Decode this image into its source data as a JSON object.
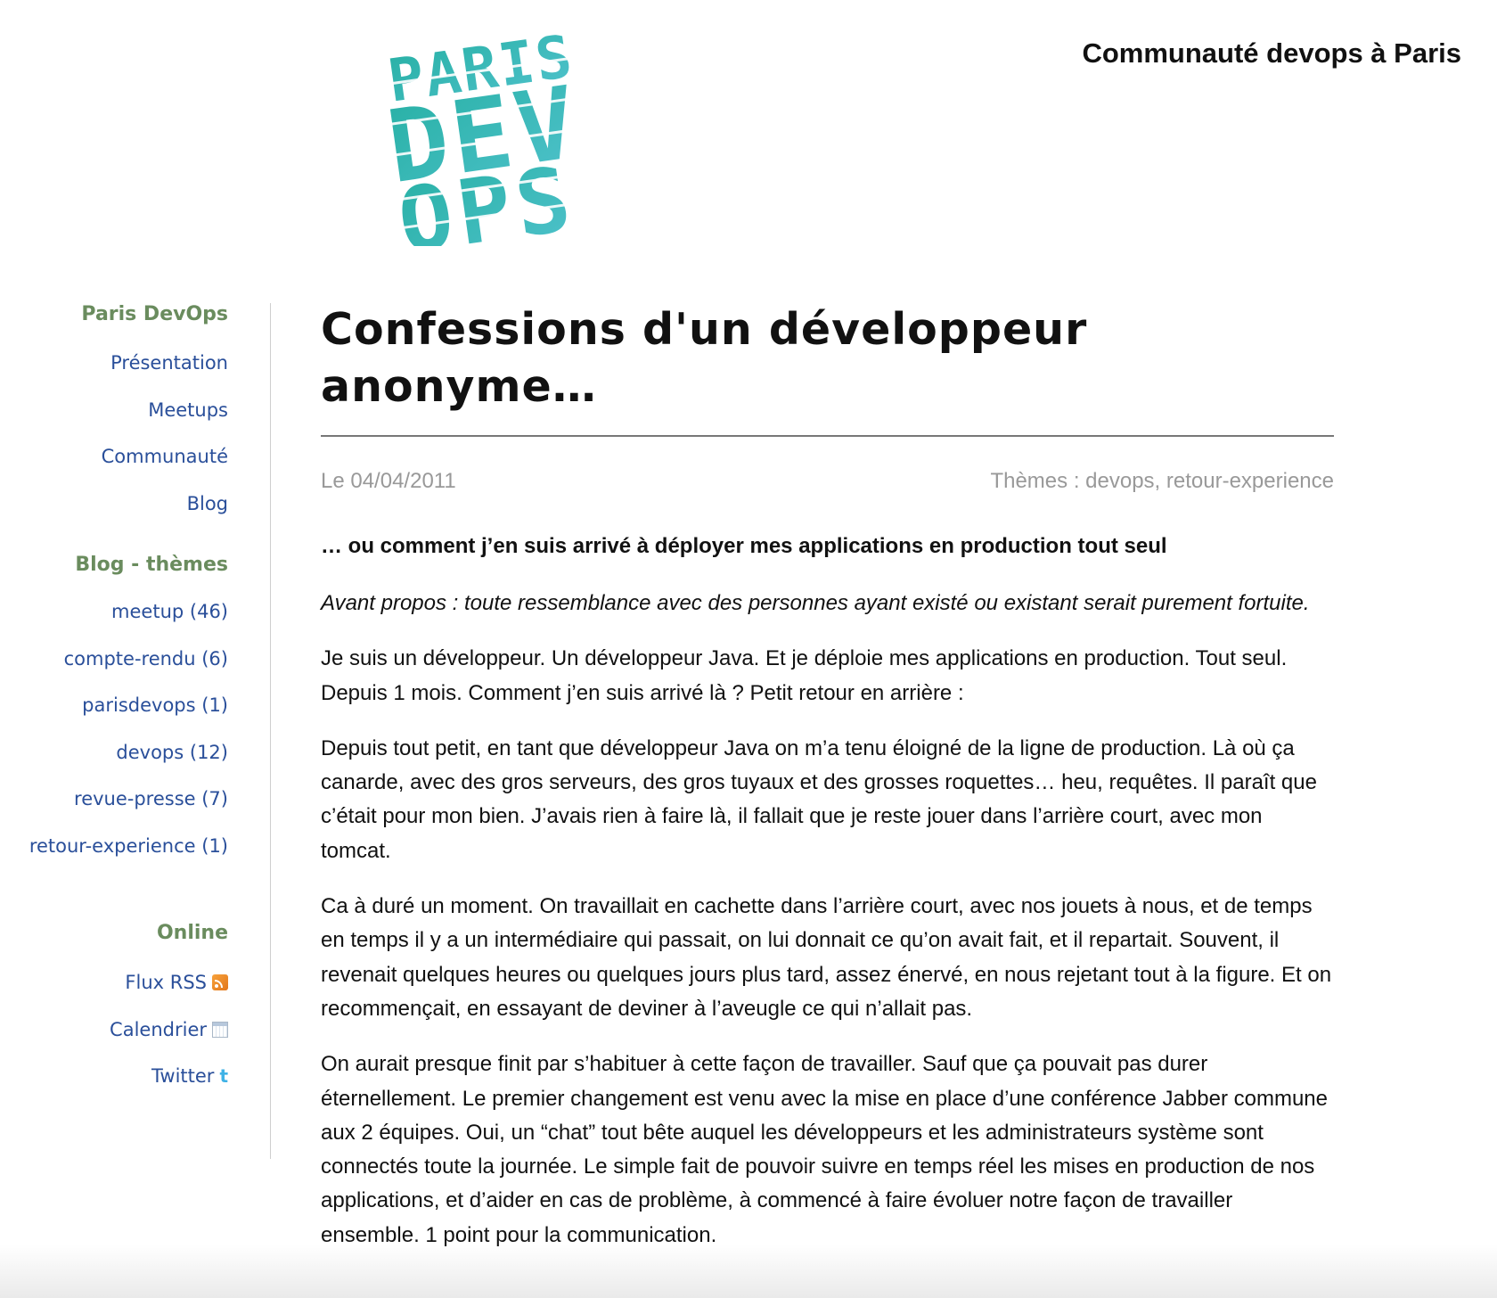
{
  "header": {
    "logo_lines": [
      "PARIS",
      "DEV",
      "OPS"
    ],
    "tagline": "Communauté devops à Paris"
  },
  "sidebar": {
    "section1": {
      "heading": "Paris DevOps",
      "items": [
        {
          "label": "Présentation"
        },
        {
          "label": "Meetups"
        },
        {
          "label": "Communauté"
        },
        {
          "label": "Blog"
        }
      ]
    },
    "section2": {
      "heading": "Blog - thèmes",
      "items": [
        {
          "label": "meetup (46)"
        },
        {
          "label": "compte-rendu (6)"
        },
        {
          "label": "parisdevops (1)"
        },
        {
          "label": "devops (12)"
        },
        {
          "label": "revue-presse (7)"
        },
        {
          "label": "retour-experience (1)"
        }
      ]
    },
    "section3": {
      "heading": "Online",
      "items": [
        {
          "label": "Flux RSS",
          "icon": "rss-icon"
        },
        {
          "label": "Calendrier",
          "icon": "calendar-icon"
        },
        {
          "label": "Twitter",
          "icon": "twitter-icon",
          "glyph": "t"
        }
      ]
    }
  },
  "post": {
    "title_line1": "Confessions d'un développeur",
    "title_line2": "anonyme…",
    "date": "Le 04/04/2011",
    "themes_prefix": "Thèmes : ",
    "theme1": "devops",
    "theme_sep": ", ",
    "theme2": "retour-experience",
    "lead": "… ou comment j’en suis arrivé à déployer mes applications en production tout seul",
    "paragraphs": [
      "Avant propos : toute ressemblance avec des personnes ayant existé ou existant serait purement fortuite.",
      "Je suis un développeur. Un développeur Java. Et je déploie mes applications en production. Tout seul. Depuis 1 mois. Comment j’en suis arrivé là ? Petit retour en arrière :",
      "Depuis tout petit, en tant que développeur Java on m’a tenu éloigné de la ligne de production. Là où ça canarde, avec des gros serveurs, des gros tuyaux et des grosses roquettes… heu, requêtes. Il paraît que c’était pour mon bien. J’avais rien à faire là, il fallait que je reste jouer dans l’arrière court, avec mon tomcat.",
      "Ca à duré un moment. On travaillait en cachette dans l’arrière court, avec nos jouets à nous, et de temps en temps il y a un intermédiaire qui passait, on lui donnait ce qu’on avait fait, et il repartait. Souvent, il revenait quelques heures ou quelques jours plus tard, assez énervé, en nous rejetant tout à la figure. Et on recommençait, en essayant de deviner à l’aveugle ce qui n’allait pas.",
      "On aurait presque finit par s’habituer à cette façon de travailler. Sauf que ça pouvait pas durer éternellement. Le premier changement est venu avec la mise en place d’une conférence Jabber commune aux 2 équipes. Oui, un “chat” tout bête auquel les développeurs et les administrateurs système sont connectés toute la journée. Le simple fait de pouvoir suivre en temps réel les mises en production de nos applications, et d’aider en cas de problème, à commencé à faire évoluer notre façon de travailler ensemble. 1 point pour la communication."
    ]
  },
  "colors": {
    "logo_teal": "#2fb3b8",
    "sidebar_heading": "#6a8c5e",
    "sidebar_link": "#2a4f9a",
    "meta_gray": "#999999"
  }
}
